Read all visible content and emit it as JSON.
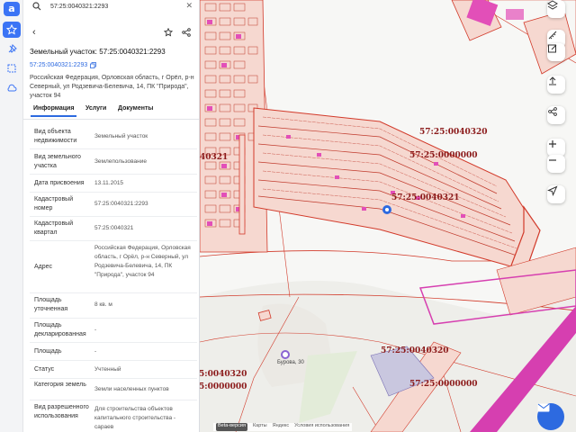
{
  "search": {
    "value": "57:25:0040321:2293"
  },
  "parcel": {
    "title": "Земельный участок: 57:25:0040321:2293",
    "cad_number": "57:25:0040321:2293",
    "address": "Российская Федерация, Орловская область, г Орёл, р-н Северный, ул Родзевича-Белевича, 14, ПК \"Природа\", участок 94"
  },
  "tabs": [
    "Информация",
    "Услуги",
    "Документы"
  ],
  "properties": [
    {
      "key": "Вид объекта недвижимости",
      "value": "Земельный участок"
    },
    {
      "key": "Вид земельного участка",
      "value": "Землепользование"
    },
    {
      "key": "Дата присвоения",
      "value": "13.11.2015"
    },
    {
      "key": "Кадастровый номер",
      "value": "57:25:0040321:2293"
    },
    {
      "key": "Кадастровый квартал",
      "value": "57:25:0040321"
    },
    {
      "key": "Адрес",
      "value": "Российская Федерация, Орловская область, г Орёл, р-н Северный, ул Родзевича-Белевича, 14, ПК \"Природа\", участок 94"
    },
    {
      "key": "Площадь уточненная",
      "value": "8 кв. м"
    },
    {
      "key": "Площадь декларированная",
      "value": "-"
    },
    {
      "key": "Площадь",
      "value": "-"
    },
    {
      "key": "Статус",
      "value": "Учтенный"
    },
    {
      "key": "Категория земель",
      "value": "Земли населенных пунктов"
    },
    {
      "key": "Вид разрешенного использования",
      "value": "Для строительства объектов капитального строительства - сараев"
    }
  ],
  "map": {
    "labels": {
      "q1": "57:25:0040320",
      "q2": "57:25:0000000",
      "q3": "57:25:0040321",
      "q4": "57:25:0040320",
      "q5": "57:25:0000000",
      "q6": "57:25:0040321",
      "q7": "5:0040320",
      "q8": "5:0000000",
      "q9": "40321"
    },
    "poi": "Бурова, 30",
    "copyright": [
      "Beta-версия",
      "Карты",
      "Яндекс",
      "Условия использования"
    ],
    "colors": {
      "parcel_fill": "#f6d8d0",
      "parcel_line": "#d23a2a",
      "magenta": "#d63fb0",
      "quarter_text": "#8b1a1a"
    }
  },
  "icons": [
    "search-icon",
    "close-icon",
    "back-icon",
    "star-icon",
    "share-icon",
    "copy-icon",
    "layers-icon",
    "ruler-icon",
    "edit-icon",
    "upload-icon",
    "share-map-icon",
    "zoom-in-icon",
    "zoom-out-icon",
    "locate-icon",
    "mail-icon"
  ]
}
